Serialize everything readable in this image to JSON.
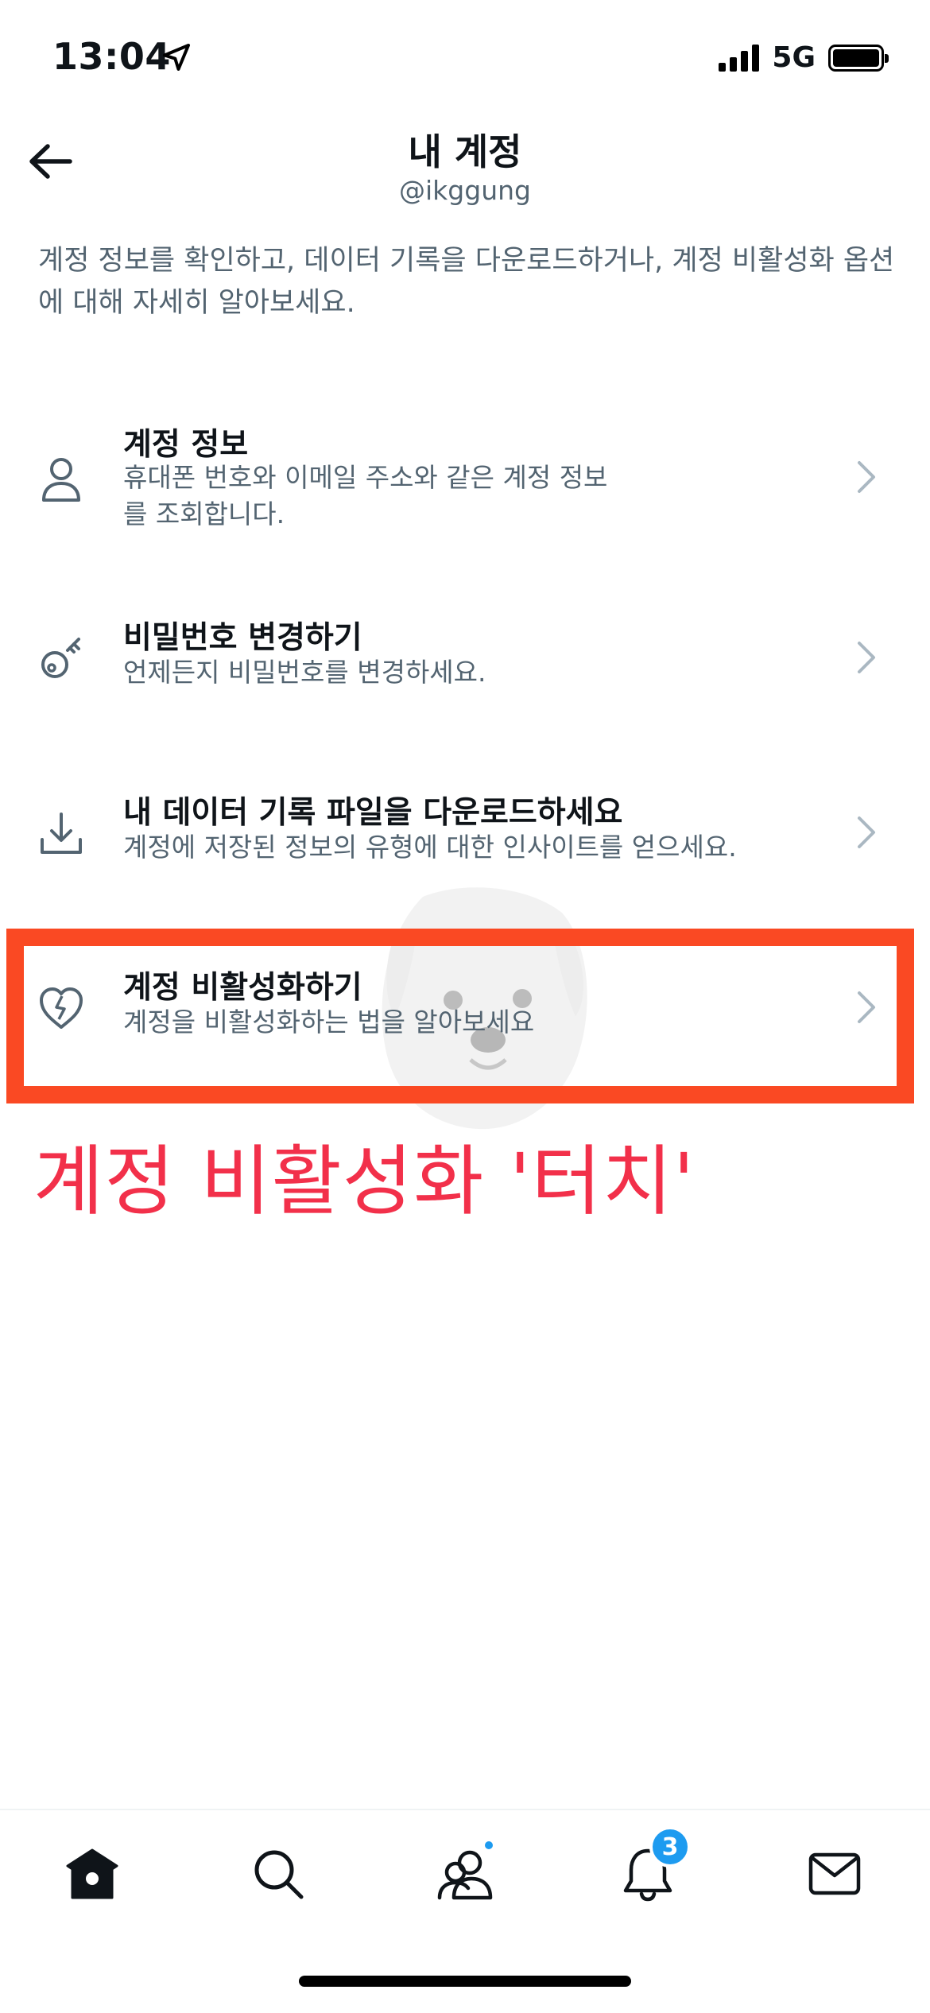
{
  "status_bar": {
    "time": "13:04",
    "network": "5G"
  },
  "header": {
    "title": "내 계정",
    "handle": "@ikggung"
  },
  "description": "계정 정보를 확인하고, 데이터 기록을 다운로드하거나, 계정 비활성화 옵션에 대해 자세히 알아보세요.",
  "items": [
    {
      "icon": "person-icon",
      "title": "계정 정보",
      "desc": "휴대폰 번호와 이메일 주소와 같은 계정 정보를 조회합니다."
    },
    {
      "icon": "key-icon",
      "title": "비밀번호 변경하기",
      "desc": "언제든지 비밀번호를 변경하세요."
    },
    {
      "icon": "download-icon",
      "title": "내 데이터 기록 파일을 다운로드하세요",
      "desc": "계정에 저장된 정보의 유형에 대한 인사이트를 얻으세요."
    },
    {
      "icon": "broken-heart-icon",
      "title": "계정 비활성화하기",
      "desc": "계정을 비활성화하는 법을 알아보세요"
    }
  ],
  "annotation": "계정 비활성화 '터치'",
  "tab_bar": {
    "notifications_badge": "3"
  },
  "colors": {
    "accent": "#1d9bf0",
    "highlight": "#fa4923",
    "annotation": "#f2304a",
    "secondary_text": "#536471"
  }
}
